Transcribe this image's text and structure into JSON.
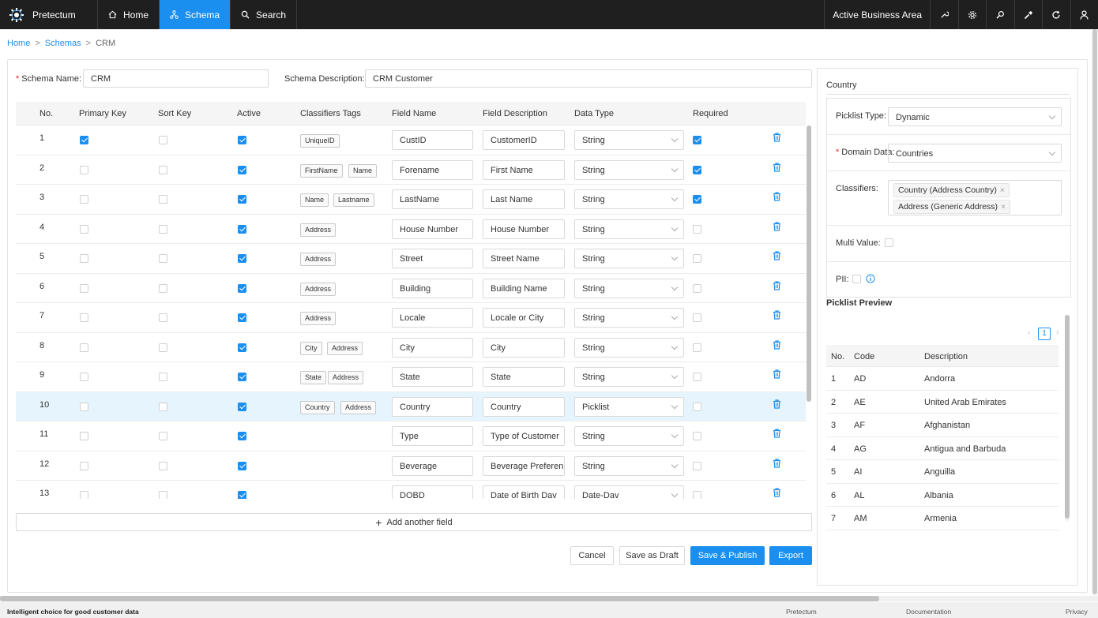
{
  "app": {
    "name": "Pretectum"
  },
  "nav": {
    "home": "Home",
    "schema": "Schema",
    "search": "Search"
  },
  "topbar": {
    "business_area": "Active Business Area",
    "icons": [
      "wrench-icon",
      "gear-icon",
      "magnify-icon",
      "tool-icon",
      "refresh-icon",
      "user-icon"
    ]
  },
  "breadcrumb": {
    "home": "Home",
    "schemas": "Schemas",
    "current": "CRM"
  },
  "schema": {
    "name_label": "Schema Name:",
    "name_value": "CRM",
    "desc_label": "Schema Description:",
    "desc_value": "CRM Customer"
  },
  "table": {
    "headers": {
      "no": "No.",
      "primary_key": "Primary Key",
      "sort_key": "Sort Key",
      "active": "Active",
      "tags": "Classifiers Tags",
      "field_name": "Field Name",
      "field_desc": "Field Description",
      "data_type": "Data Type",
      "required": "Required"
    },
    "rows": [
      {
        "no": "1",
        "pk": true,
        "sk": false,
        "active": true,
        "tags": [
          "UniqueID"
        ],
        "name": "CustID",
        "desc": "CustomerID",
        "type": "String",
        "required": true
      },
      {
        "no": "2",
        "pk": false,
        "sk": false,
        "active": true,
        "tags": [
          "FirstName",
          "Name"
        ],
        "name": "Forename",
        "desc": "First Name",
        "type": "String",
        "required": true
      },
      {
        "no": "3",
        "pk": false,
        "sk": false,
        "active": true,
        "tags": [
          "Name",
          "Lastname"
        ],
        "name": "LastName",
        "desc": "Last Name",
        "type": "String",
        "required": true
      },
      {
        "no": "4",
        "pk": false,
        "sk": false,
        "active": true,
        "tags": [
          "Address"
        ],
        "name": "House Number",
        "desc": "House Number",
        "type": "String",
        "required": false
      },
      {
        "no": "5",
        "pk": false,
        "sk": false,
        "active": true,
        "tags": [
          "Address"
        ],
        "name": "Street",
        "desc": "Street Name",
        "type": "String",
        "required": false
      },
      {
        "no": "6",
        "pk": false,
        "sk": false,
        "active": true,
        "tags": [
          "Address"
        ],
        "name": "Building",
        "desc": "Building Name",
        "type": "String",
        "required": false
      },
      {
        "no": "7",
        "pk": false,
        "sk": false,
        "active": true,
        "tags": [
          "Address"
        ],
        "name": "Locale",
        "desc": "Locale or City",
        "type": "String",
        "required": false
      },
      {
        "no": "8",
        "pk": false,
        "sk": false,
        "active": true,
        "tags": [
          "City",
          "Address"
        ],
        "name": "City",
        "desc": "City",
        "type": "String",
        "required": false
      },
      {
        "no": "9",
        "pk": false,
        "sk": false,
        "active": true,
        "tags": [
          "State",
          "Address"
        ],
        "name": "State",
        "desc": "State",
        "type": "String",
        "required": false
      },
      {
        "no": "10",
        "pk": false,
        "sk": false,
        "active": true,
        "tags": [
          "Country",
          "Address"
        ],
        "name": "Country",
        "desc": "Country",
        "type": "Picklist",
        "required": false,
        "selected": true
      },
      {
        "no": "11",
        "pk": false,
        "sk": false,
        "active": true,
        "tags": [],
        "name": "Type",
        "desc": "Type of Customer",
        "type": "String",
        "required": false
      },
      {
        "no": "12",
        "pk": false,
        "sk": false,
        "active": true,
        "tags": [],
        "name": "Beverage",
        "desc": "Beverage Preferen",
        "type": "String",
        "required": false
      },
      {
        "no": "13",
        "pk": false,
        "sk": false,
        "active": true,
        "tags": [],
        "name": "DOBD",
        "desc": "Date of Birth Dav",
        "type": "Date-Dav",
        "required": false
      }
    ]
  },
  "actions": {
    "add_field": "Add another field",
    "cancel": "Cancel",
    "save_draft": "Save as Draft",
    "save_publish": "Save & Publish",
    "export": "Export"
  },
  "side": {
    "title": "Country",
    "picklist_type_label": "Picklist Type:",
    "picklist_type_value": "Dynamic",
    "domain_data_label": "Domain Data:",
    "domain_data_value": "Countries",
    "classifiers_label": "Classifiers:",
    "classifiers": [
      "Country (Address Country)",
      "Address (Generic Address)"
    ],
    "multi_value_label": "Multi Value:",
    "pii_label": "PII:",
    "preview_title": "Picklist Preview",
    "page": "1",
    "preview_headers": {
      "no": "No.",
      "code": "Code",
      "desc": "Description"
    },
    "preview_rows": [
      {
        "no": "1",
        "code": "AD",
        "desc": "Andorra"
      },
      {
        "no": "2",
        "code": "AE",
        "desc": "United Arab Emirates"
      },
      {
        "no": "3",
        "code": "AF",
        "desc": "Afghanistan"
      },
      {
        "no": "4",
        "code": "AG",
        "desc": "Antigua and Barbuda"
      },
      {
        "no": "5",
        "code": "AI",
        "desc": "Anguilla"
      },
      {
        "no": "6",
        "code": "AL",
        "desc": "Albania"
      },
      {
        "no": "7",
        "code": "AM",
        "desc": "Armenia"
      }
    ]
  },
  "footer": {
    "tagline": "Intelligent choice for good customer data",
    "brand": "Pretectum",
    "docs": "Documentation",
    "privacy": "Privacy"
  },
  "colors": {
    "accent": "#1a8ff0",
    "topbar": "#1f1f1f",
    "selected_row": "#e6f4fd"
  }
}
